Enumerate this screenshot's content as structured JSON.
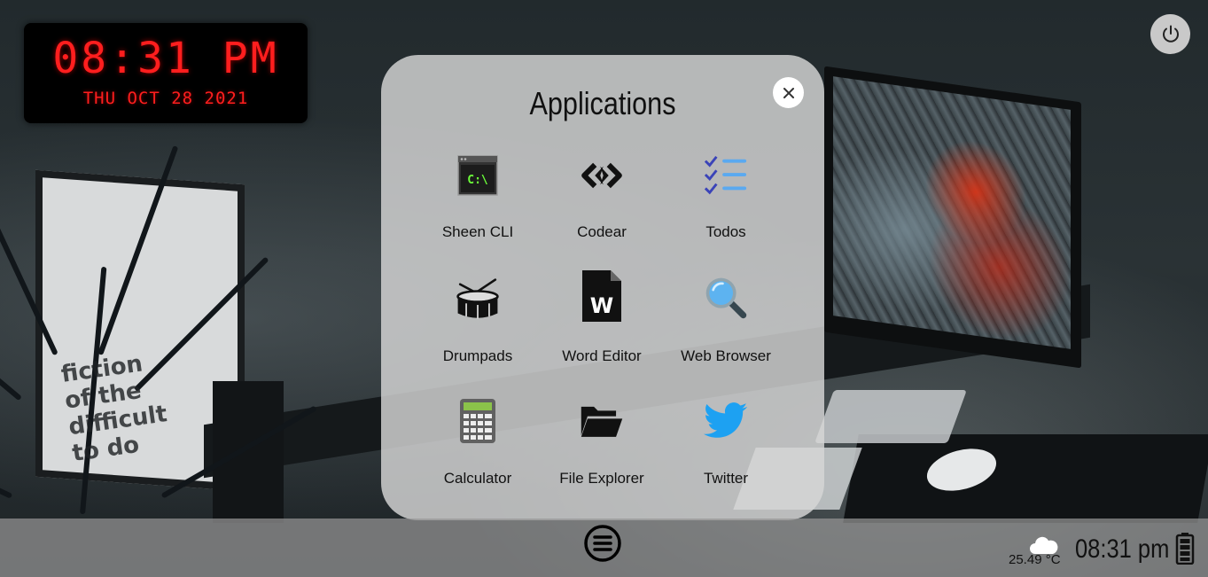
{
  "clock": {
    "time": "08:31 PM",
    "date": "THU OCT 28 2021",
    "color": "#ff1e1e"
  },
  "power": {
    "icon": "power-icon"
  },
  "app_window": {
    "title": "Applications",
    "close_icon": "close-icon",
    "apps": [
      {
        "label": "Sheen CLI",
        "icon": "terminal-icon"
      },
      {
        "label": "Codear",
        "icon": "code-brackets-icon"
      },
      {
        "label": "Todos",
        "icon": "checklist-icon"
      },
      {
        "label": "Drumpads",
        "icon": "drum-icon"
      },
      {
        "label": "Word Editor",
        "icon": "word-document-icon"
      },
      {
        "label": "Web Browser",
        "icon": "magnifier-icon"
      },
      {
        "label": "Calculator",
        "icon": "calculator-icon"
      },
      {
        "label": "File Explorer",
        "icon": "folder-icon"
      },
      {
        "label": "Twitter",
        "icon": "twitter-bird-icon"
      }
    ]
  },
  "terminal_icon_text": "C:\\",
  "word_icon_letter": "W",
  "taskbar": {
    "menu_icon": "menu-icon",
    "weather": {
      "temperature": "25.49 °C",
      "icon": "cloud-icon"
    },
    "time": "08:31 pm",
    "battery_icon": "battery-icon"
  },
  "wallpaper_text": "fiction of the difficult to do"
}
